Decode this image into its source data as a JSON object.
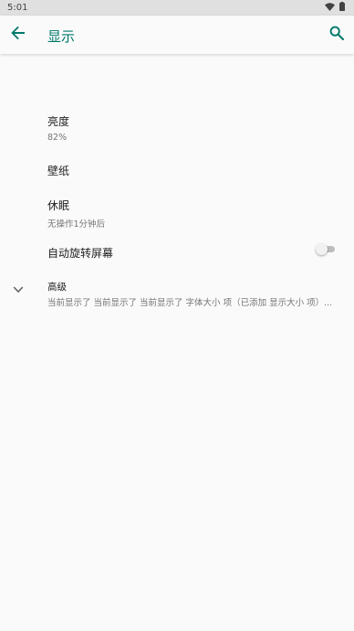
{
  "status_bar": {
    "time": "5:01"
  },
  "app_bar": {
    "title": "显示"
  },
  "settings": {
    "brightness": {
      "title": "亮度",
      "summary": "82%"
    },
    "wallpaper": {
      "title": "壁纸"
    },
    "sleep": {
      "title": "休眠",
      "summary": "无操作1分钟后"
    },
    "auto_rotate": {
      "title": "自动旋转屏幕",
      "enabled": false
    },
    "advanced": {
      "title": "高级",
      "summary": "当前显示了 当前显示了 当前显示了 字体大小 项（已添加 显示大小 项）..."
    }
  },
  "colors": {
    "accent": "#00796b",
    "background": "#fafafa",
    "status_bar": "#e0e0e0"
  }
}
